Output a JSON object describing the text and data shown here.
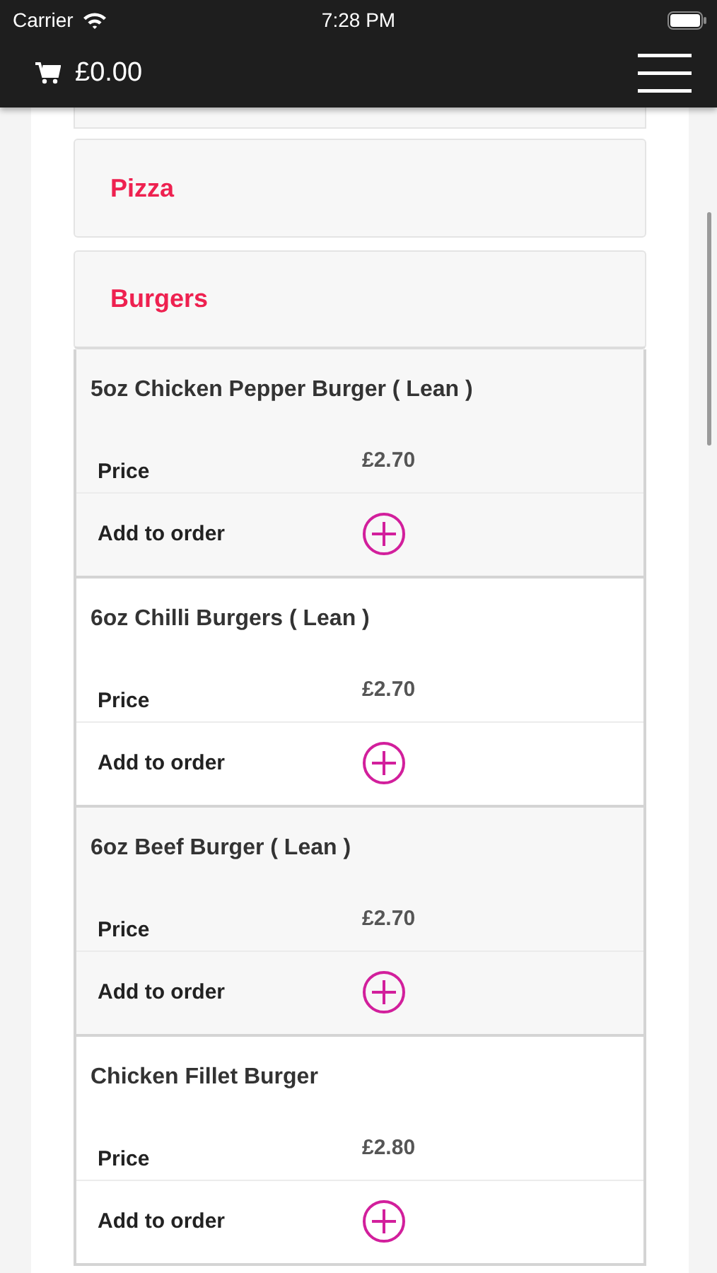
{
  "status_bar": {
    "carrier": "Carrier",
    "time": "7:28 PM"
  },
  "header": {
    "cart_total": "£0.00"
  },
  "categories": [
    {
      "name": "Pizza",
      "expanded": false
    },
    {
      "name": "Burgers",
      "expanded": true
    }
  ],
  "items": [
    {
      "name": "5oz Chicken Pepper Burger ( Lean )",
      "price_label": "Price",
      "price": "£2.70",
      "add_label": "Add to order"
    },
    {
      "name": "6oz Chilli Burgers ( Lean )",
      "price_label": "Price",
      "price": "£2.70",
      "add_label": "Add to order"
    },
    {
      "name": "6oz Beef Burger ( Lean )",
      "price_label": "Price",
      "price": "£2.70",
      "add_label": "Add to order"
    },
    {
      "name": "Chicken Fillet Burger",
      "price_label": "Price",
      "price": "£2.80",
      "add_label": "Add to order"
    }
  ]
}
